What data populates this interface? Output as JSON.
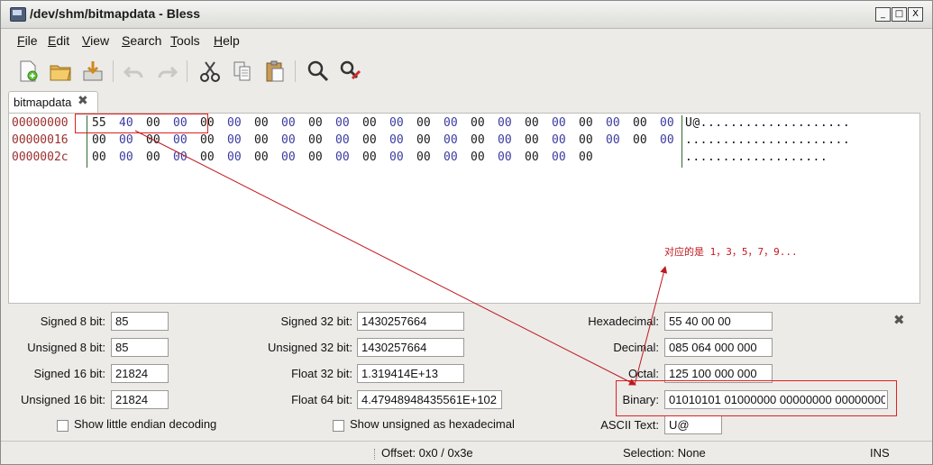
{
  "window": {
    "title": "/dev/shm/bitmapdata - Bless",
    "buttons": [
      "_",
      "□",
      "X"
    ]
  },
  "menu": [
    "File",
    "Edit",
    "View",
    "Search",
    "Tools",
    "Help"
  ],
  "menu_mnemonics": [
    "F",
    "E",
    "V",
    "S",
    "T",
    "H"
  ],
  "toolbar": {
    "icons": [
      "new-file-icon",
      "open-folder-icon",
      "save-icon",
      "undo-icon",
      "redo-icon",
      "cut-icon",
      "copy-icon",
      "paste-icon",
      "find-icon",
      "find-replace-icon"
    ]
  },
  "tab": {
    "label": "bitmapdata",
    "close": "✖"
  },
  "hex": {
    "rows": [
      {
        "offset": "00000000",
        "bytes": [
          "55",
          "40",
          "00",
          "00",
          "00",
          "00",
          "00",
          "00",
          "00",
          "00",
          "00",
          "00",
          "00",
          "00",
          "00",
          "00",
          "00",
          "00",
          "00",
          "00",
          "00",
          "00"
        ],
        "ascii": "U@...................."
      },
      {
        "offset": "00000016",
        "bytes": [
          "00",
          "00",
          "00",
          "00",
          "00",
          "00",
          "00",
          "00",
          "00",
          "00",
          "00",
          "00",
          "00",
          "00",
          "00",
          "00",
          "00",
          "00",
          "00",
          "00",
          "00",
          "00"
        ],
        "ascii": "......................"
      },
      {
        "offset": "0000002c",
        "bytes": [
          "00",
          "00",
          "00",
          "00",
          "00",
          "00",
          "00",
          "00",
          "00",
          "00",
          "00",
          "00",
          "00",
          "00",
          "00",
          "00",
          "00",
          "00",
          "00"
        ],
        "ascii": "..................."
      }
    ]
  },
  "annotation": {
    "note": "对应的是 1，3，5，7，9..."
  },
  "conversion": {
    "signed8_label": "Signed 8 bit:",
    "signed8": "85",
    "unsigned8_label": "Unsigned 8 bit:",
    "unsigned8": "85",
    "signed16_label": "Signed 16 bit:",
    "signed16": "21824",
    "unsigned16_label": "Unsigned 16 bit:",
    "unsigned16": "21824",
    "signed32_label": "Signed 32 bit:",
    "signed32": "1430257664",
    "unsigned32_label": "Unsigned 32 bit:",
    "unsigned32": "1430257664",
    "float32_label": "Float 32 bit:",
    "float32": "1.319414E+13",
    "float64_label": "Float 64 bit:",
    "float64": "4.47948948435561E+102",
    "hex_label": "Hexadecimal:",
    "hex": "55 40 00 00",
    "dec_label": "Decimal:",
    "dec": "085 064 000 000",
    "oct_label": "Octal:",
    "oct": "125 100 000 000",
    "bin_label": "Binary:",
    "bin": "01010101 01000000 00000000 00000000",
    "ascii_label": "ASCII Text:",
    "ascii": "U@",
    "little_endian_label": "Show little endian decoding",
    "unsigned_hex_label": "Show unsigned as hexadecimal",
    "close": "✖"
  },
  "status": {
    "offset": "Offset: 0x0 / 0x3e",
    "selection": "Selection: None",
    "mode": "INS"
  },
  "colors": {
    "accent_red": "#e02020",
    "offset_color": "#9b2f2f",
    "odd_byte": "#3a3aa0"
  }
}
